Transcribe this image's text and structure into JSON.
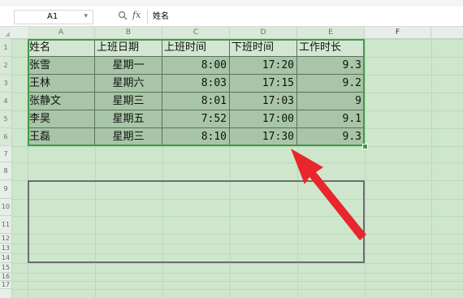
{
  "formula_bar": {
    "cell_ref": "A1",
    "dropdown_glyph": "▾",
    "fx_label": "fx",
    "content": "姓名"
  },
  "columns": [
    "A",
    "B",
    "C",
    "D",
    "E",
    "F"
  ],
  "rows": [
    "1",
    "2",
    "3",
    "4",
    "5",
    "6",
    "7",
    "8",
    "9",
    "10",
    "11",
    "12",
    "13",
    "14",
    "15",
    "16",
    "17"
  ],
  "table": {
    "headers": [
      "姓名",
      "上班日期",
      "上班时间",
      "下班时间",
      "工作时长"
    ],
    "rows": [
      [
        "张雪",
        "星期一",
        "8:00",
        "17:20",
        "9.3"
      ],
      [
        "王林",
        "星期六",
        "8:03",
        "17:15",
        "9.2"
      ],
      [
        "张静文",
        "星期三",
        "8:01",
        "17:03",
        "9"
      ],
      [
        "李昊",
        "星期五",
        "7:52",
        "17:00",
        "9.1"
      ],
      [
        "王磊",
        "星期三",
        "8:10",
        "17:30",
        "9.3"
      ]
    ]
  },
  "colors": {
    "sheet_fill": "#cde6cc",
    "selection_fill": "#a8c6a7",
    "selection_border": "#3f9b45",
    "arrow": "#e8262b",
    "box_border": "#6d6d6d"
  }
}
